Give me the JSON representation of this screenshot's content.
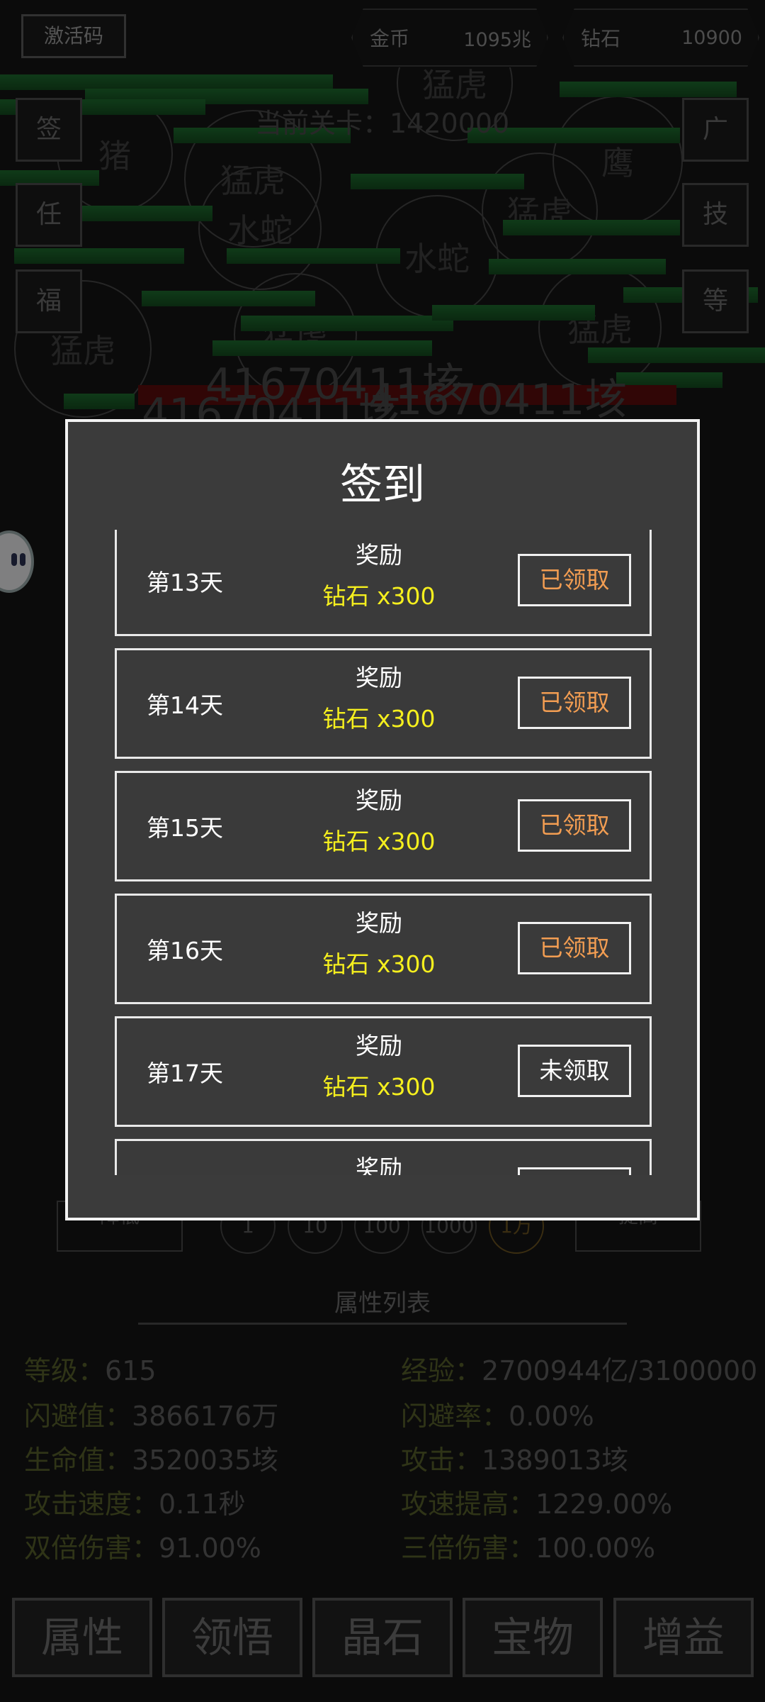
{
  "topbar": {
    "activation_code": "激活码",
    "gold_label": "金币",
    "gold_value": "1095兆",
    "diamond_label": "钻石",
    "diamond_value": "10900"
  },
  "battle": {
    "stage_text": "当前关卡：1420000",
    "enemies": [
      "猛虎",
      "猪",
      "水蛇",
      "猛虎",
      "水蛇",
      "鹰",
      "猛虎",
      "猛虎",
      "猛虎",
      "猛虎"
    ],
    "damage_text_1": "41670411垓",
    "damage_text_2": "41670411垓",
    "damage_text_3": "41670411垓"
  },
  "left_menu": [
    "签",
    "任",
    "福"
  ],
  "right_menu": [
    "广",
    "技",
    "等"
  ],
  "controls": {
    "decrease": "降低",
    "increase": "提高",
    "multipliers": [
      "1",
      "10",
      "100",
      "1000",
      "1万"
    ],
    "active_multiplier": "1万"
  },
  "attributes": {
    "title": "属性列表",
    "items": [
      {
        "k": "等级：",
        "v": "615"
      },
      {
        "k": "经验：",
        "v": "2700944亿/3100000"
      },
      {
        "k": "闪避值：",
        "v": "3866176万"
      },
      {
        "k": "闪避率：",
        "v": "0.00%"
      },
      {
        "k": "生命值：",
        "v": "3520035垓"
      },
      {
        "k": "攻击：",
        "v": "1389013垓"
      },
      {
        "k": "攻击速度：",
        "v": "0.11秒"
      },
      {
        "k": "攻速提高：",
        "v": "1229.00%"
      },
      {
        "k": "双倍伤害：",
        "v": "91.00%"
      },
      {
        "k": "三倍伤害：",
        "v": "100.00%"
      }
    ]
  },
  "bottom_nav": [
    "属性",
    "领悟",
    "晶石",
    "宝物",
    "增益"
  ],
  "signin": {
    "title": "签到",
    "rows": [
      {
        "day": "第13天",
        "reward_label": "奖励",
        "reward": "钻石 x300",
        "status": "已领取",
        "claimed": true
      },
      {
        "day": "第14天",
        "reward_label": "奖励",
        "reward": "钻石 x300",
        "status": "已领取",
        "claimed": true
      },
      {
        "day": "第15天",
        "reward_label": "奖励",
        "reward": "钻石 x300",
        "status": "已领取",
        "claimed": true
      },
      {
        "day": "第16天",
        "reward_label": "奖励",
        "reward": "钻石 x300",
        "status": "已领取",
        "claimed": true
      },
      {
        "day": "第17天",
        "reward_label": "奖励",
        "reward": "钻石 x300",
        "status": "未领取",
        "claimed": false
      },
      {
        "day": "",
        "reward_label": "奖励",
        "reward": "",
        "status": "",
        "claimed": false
      }
    ]
  },
  "colors": {
    "claimed": "#f29d52",
    "reward": "#f5ef1e",
    "modal_bg": "#3b3b3b"
  }
}
